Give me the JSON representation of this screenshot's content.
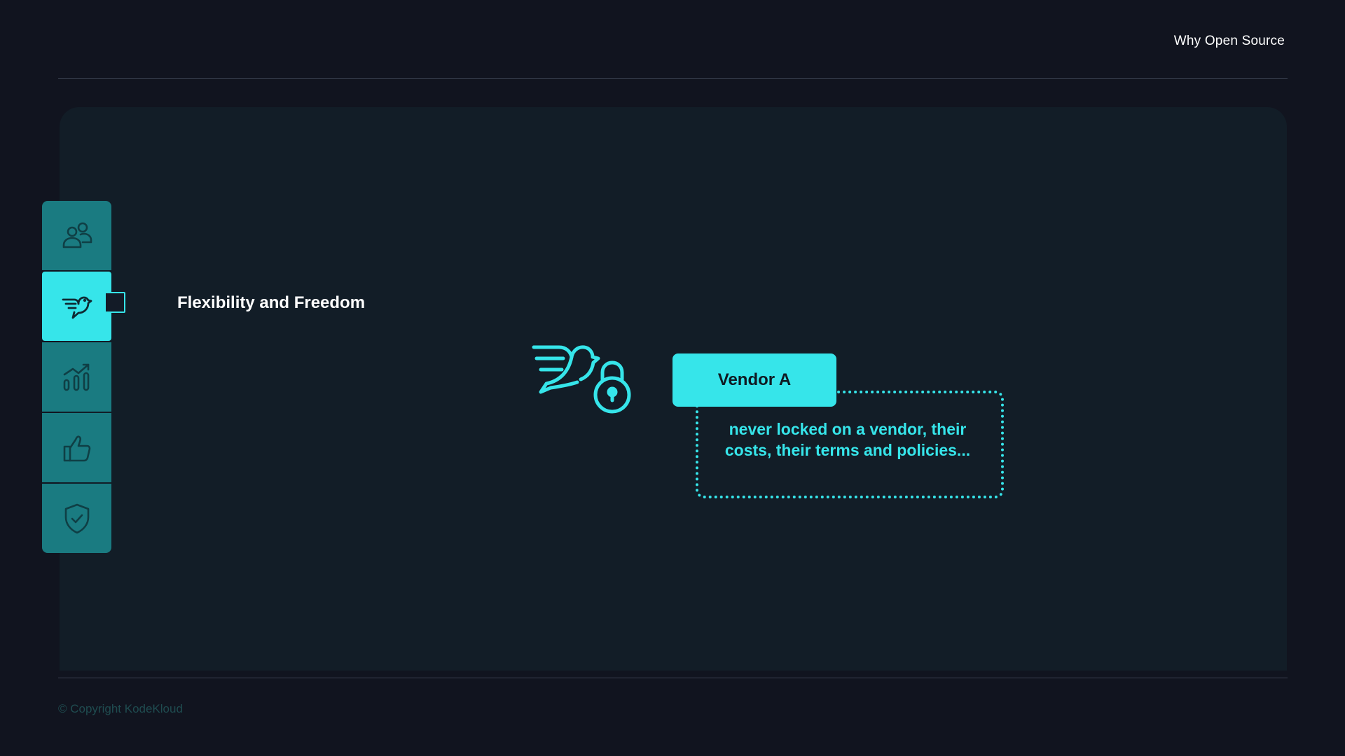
{
  "header": {
    "title": "Why Open Source"
  },
  "sidebar": {
    "items": [
      {
        "icon": "people-icon",
        "active": false
      },
      {
        "icon": "dove-icon",
        "active": true
      },
      {
        "icon": "growth-chart-icon",
        "active": false
      },
      {
        "icon": "thumbs-up-icon",
        "active": false
      },
      {
        "icon": "shield-check-icon",
        "active": false
      }
    ]
  },
  "main": {
    "section_title": "Flexibility and Freedom",
    "central_icon": "dove-lock-icon",
    "vendor_label": "Vendor A",
    "vendor_description": "never locked on a vendor, their costs, their terms and policies..."
  },
  "footer": {
    "copyright": "© Copyright KodeKloud"
  },
  "colors": {
    "background": "#11141f",
    "panel": "#121d27",
    "accent": "#36e5ea",
    "sidebar_item": "#1a7b81"
  }
}
